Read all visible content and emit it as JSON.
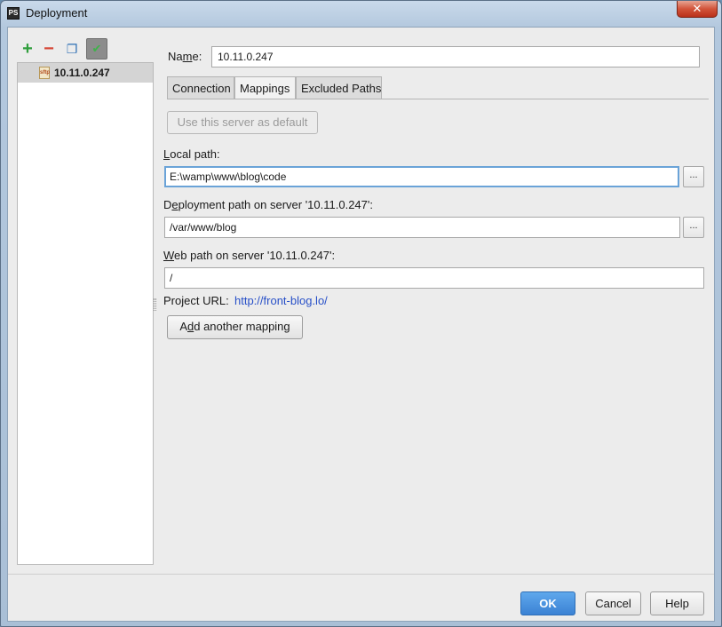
{
  "window": {
    "title": "Deployment",
    "close_glyph": "✕"
  },
  "toolbar": {
    "add_glyph": "+",
    "remove_glyph": "−",
    "copy_glyph": "❐",
    "default_glyph": "✔"
  },
  "servers": [
    {
      "icon_text": "sftp",
      "label": "10.11.0.247"
    }
  ],
  "form": {
    "name_label_pre": "Na",
    "name_label_mnemonic": "m",
    "name_label_post": "e:",
    "name_value": "10.11.0.247"
  },
  "tabs": [
    {
      "label": "Connection",
      "active": false
    },
    {
      "label": "Mappings",
      "active": true
    },
    {
      "label": "Excluded Paths",
      "active": false
    }
  ],
  "mappings": {
    "default_button_label": "Use this server as default",
    "local_path_mnemonic": "L",
    "local_path_label_rest": "ocal path:",
    "local_path_value": "E:\\wamp\\www\\blog\\code",
    "deploy_path_pre": "D",
    "deploy_path_mnemonic": "e",
    "deploy_path_label_rest": "ployment path on server '10.11.0.247':",
    "deploy_path_value": "/var/www/blog",
    "web_path_mnemonic": "W",
    "web_path_label_rest": "eb path on server '10.11.0.247':",
    "web_path_value": "/",
    "browse_label": "...",
    "project_url_label": "Project URL:",
    "project_url_value": "http://front-blog.lo/",
    "add_mapping_pre": "A",
    "add_mapping_mnemonic": "d",
    "add_mapping_rest": "d another mapping"
  },
  "buttons": {
    "ok": "OK",
    "cancel": "Cancel",
    "help": "Help"
  },
  "colors": {
    "ok_button": "#3b82d4",
    "link": "#2850c8",
    "close_button": "#d2543a"
  }
}
